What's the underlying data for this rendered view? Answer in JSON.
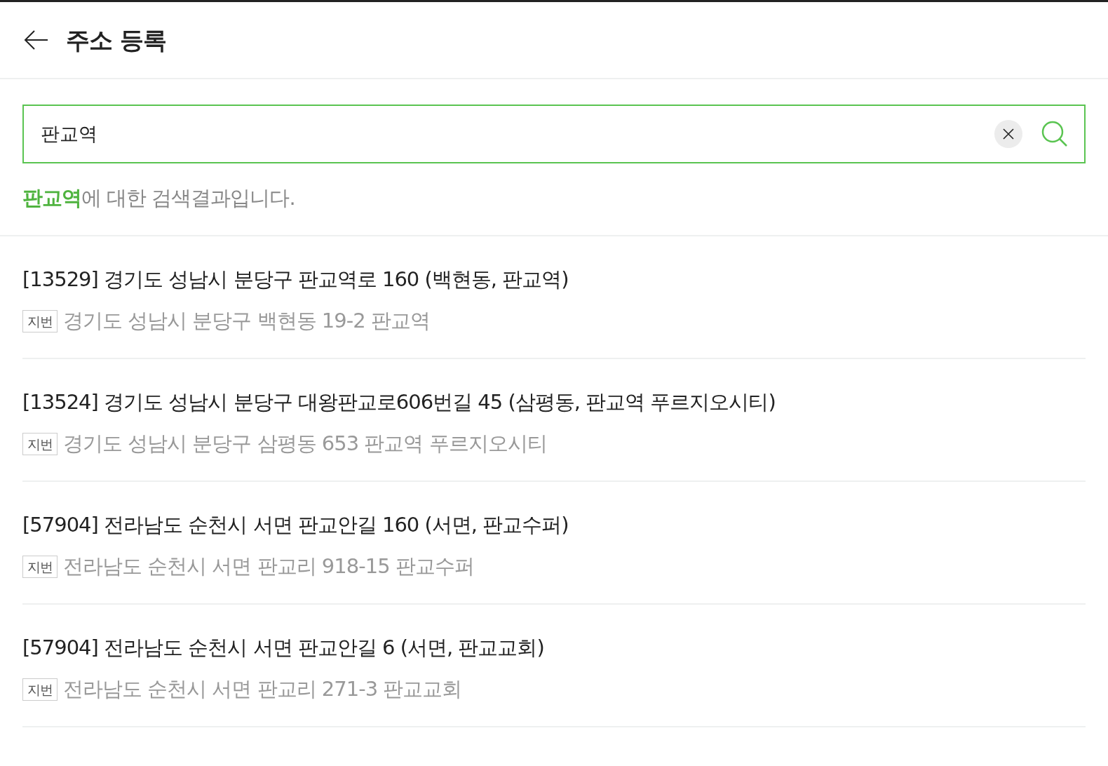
{
  "header": {
    "title": "주소 등록"
  },
  "search": {
    "value": "판교역"
  },
  "result_message": {
    "query": "판교역",
    "text": "에 대한 검색결과입니다."
  },
  "results": [
    {
      "road_address": "[13529] 경기도 성남시 분당구 판교역로 160 (백현동, 판교역)",
      "badge": "지번",
      "lot_address": "경기도 성남시 분당구 백현동 19-2 판교역"
    },
    {
      "road_address": "[13524] 경기도 성남시 분당구 대왕판교로606번길 45 (삼평동, 판교역 푸르지오시티)",
      "badge": "지번",
      "lot_address": "경기도 성남시 분당구 삼평동 653 판교역 푸르지오시티"
    },
    {
      "road_address": "[57904] 전라남도 순천시 서면 판교안길 160 (서면, 판교수퍼)",
      "badge": "지번",
      "lot_address": "전라남도 순천시 서면 판교리 918-15 판교수퍼"
    },
    {
      "road_address": "[57904] 전라남도 순천시 서면 판교안길 6 (서면, 판교교회)",
      "badge": "지번",
      "lot_address": "전라남도 순천시 서면 판교리 271-3 판교교회"
    }
  ]
}
